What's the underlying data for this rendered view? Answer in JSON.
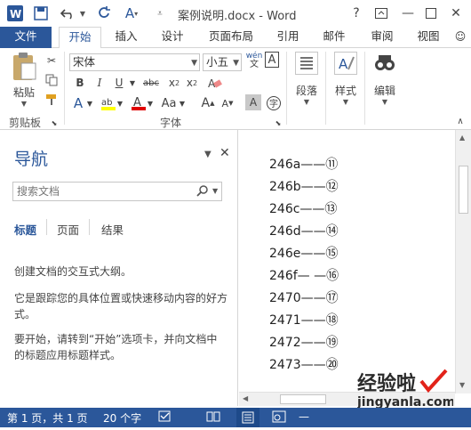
{
  "titlebar": {
    "title": "案例说明.docx - Word",
    "help": "?",
    "icons": [
      "word-logo-icon",
      "save-icon",
      "undo-icon",
      "redo-icon",
      "font-color-icon",
      "customize-icon"
    ]
  },
  "tabs": [
    "文件",
    "开始",
    "插入",
    "设计",
    "页面布局",
    "引用",
    "邮件",
    "审阅",
    "视图"
  ],
  "active_tab": "开始",
  "ribbon": {
    "clipboard": {
      "paste": "粘贴",
      "label": "剪贴板"
    },
    "font": {
      "name": "宋体",
      "size": "小五",
      "label": "字体",
      "wen": "wén",
      "a_big": "A"
    },
    "paragraph": {
      "label": "段落"
    },
    "styles": {
      "label": "样式"
    },
    "editing": {
      "label": "编辑"
    }
  },
  "nav": {
    "title": "导航",
    "search_placeholder": "搜索文档",
    "tabs": [
      "标题",
      "页面",
      "结果"
    ],
    "p1": "创建文档的交互式大纲。",
    "p2": "它是跟踪您的具体位置或快速移动内容的好方式。",
    "p3": "要开始，请转到“开始”选项卡，并向文档中的标题应用标题样式。"
  },
  "document": {
    "lines": [
      "246a——⑪",
      "246b——⑫",
      "246c——⑬",
      "246d——⑭",
      "246e——⑮",
      "246f— —⑯",
      "2470——⑰",
      "2471——⑱",
      "2472——⑲",
      "2473——⑳"
    ]
  },
  "status": {
    "page": "第 1 页，共 1 页",
    "words": "20 个字"
  },
  "watermark": {
    "line1": "经验啦",
    "line2": "jingyanla.com"
  },
  "colors": {
    "accent": "#2b579a",
    "highlight": "#ffff00",
    "font_red": "#e00000"
  }
}
